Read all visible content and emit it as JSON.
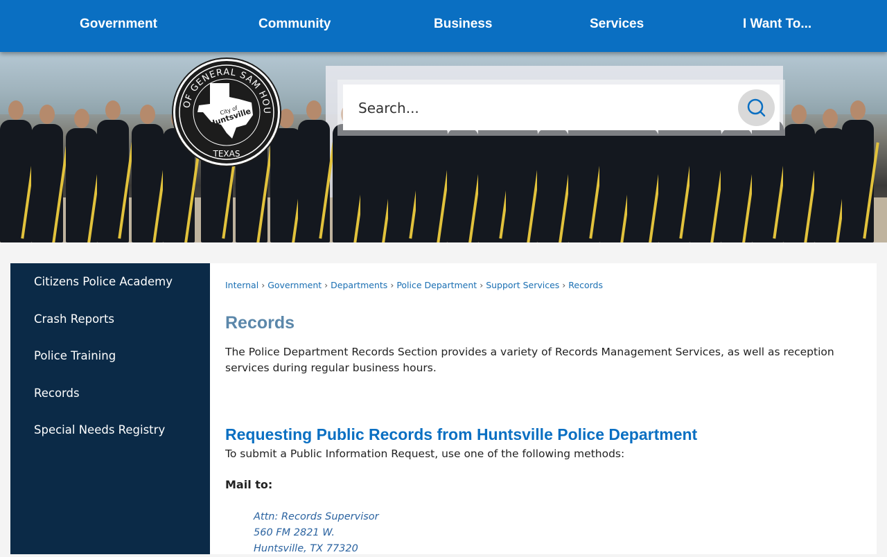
{
  "nav": {
    "items": [
      {
        "label": "Government"
      },
      {
        "label": "Community"
      },
      {
        "label": "Business"
      },
      {
        "label": "Services"
      },
      {
        "label": "I Want To..."
      }
    ]
  },
  "seal": {
    "outer_text": "HOME OF GENERAL SAM HOUSTON",
    "bottom_text": "TEXAS",
    "city_small": "City of",
    "city_name": "Huntsville"
  },
  "search": {
    "placeholder": "Search...",
    "icon": "search-icon"
  },
  "sidebar": {
    "items": [
      {
        "label": "Citizens Police Academy"
      },
      {
        "label": "Crash Reports"
      },
      {
        "label": "Police Training"
      },
      {
        "label": "Records"
      },
      {
        "label": "Special Needs Registry"
      }
    ]
  },
  "breadcrumb": {
    "items": [
      {
        "label": "Internal"
      },
      {
        "label": "Government"
      },
      {
        "label": "Departments"
      },
      {
        "label": "Police Department"
      },
      {
        "label": "Support Services"
      },
      {
        "label": "Records"
      }
    ],
    "separator": "›"
  },
  "content": {
    "title": "Records",
    "intro": "The Police Department Records Section provides a variety of Records Management Services, as well as reception services during regular business hours.",
    "section_heading": "Requesting Public Records from Huntsville Police Department",
    "section_text": "To submit a Public Information Request, use one of the following methods:",
    "mail_label": "Mail to:",
    "address": {
      "line1": "Attn: Records Supervisor",
      "line2": "560 FM 2821 W.",
      "line3": "Huntsville, TX 77320"
    }
  },
  "colors": {
    "nav_bg": "#0a6fc2",
    "sidebar_bg": "#0b2a47",
    "title": "#5b87aa",
    "heading": "#0a6fc2",
    "link": "#1a6fb3"
  }
}
